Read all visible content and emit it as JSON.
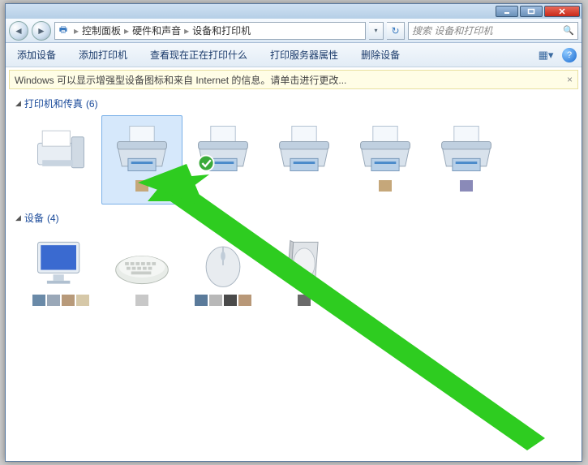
{
  "titlebar": {
    "min_tip": "Minimize",
    "max_tip": "Maximize",
    "close_tip": "Close"
  },
  "nav": {
    "back_tip": "Back",
    "fwd_tip": "Forward",
    "crumbs": [
      "控制面板",
      "硬件和声音",
      "设备和打印机"
    ],
    "refresh_tip": "Refresh"
  },
  "search": {
    "placeholder": "搜索 设备和打印机"
  },
  "toolbar": {
    "items": [
      "添加设备",
      "添加打印机",
      "查看现在正在打印什么",
      "打印服务器属性",
      "删除设备"
    ],
    "help_tip": "?"
  },
  "infobar": {
    "text": "Windows 可以显示增强型设备图标和来自 Internet 的信息。请单击进行更改...",
    "close": "×"
  },
  "groups": {
    "printers": {
      "label": "打印机和传真",
      "count": "(6)"
    },
    "devices": {
      "label": "设备",
      "count": "(4)"
    }
  },
  "swatch_colors": {
    "printer2": [
      "#c5a77a"
    ],
    "printer5": [
      "#c5a77a"
    ],
    "printer6": [
      "#8a8ab8"
    ],
    "dev_monitor": [
      "#6a8aa8",
      "#9aa8b8",
      "#b89a7a",
      "#d6c8a8"
    ],
    "dev_keyboard": [
      "#c8c8c8"
    ],
    "dev_mouse": [
      "#5a7a9a",
      "#b8b8b8",
      "#4a4a4a",
      "#b89878"
    ],
    "dev_disk": [
      "#6a6a6a"
    ]
  }
}
